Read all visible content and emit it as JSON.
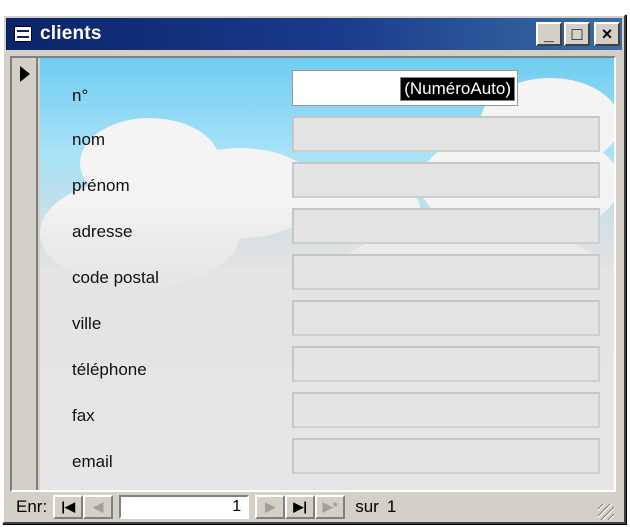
{
  "window": {
    "title": "clients",
    "title_icon": "form-icon",
    "minimize": "_",
    "maximize": "□",
    "close": "×"
  },
  "fields": [
    {
      "label": "n°",
      "value": "(NuméroAuto)"
    },
    {
      "label": "nom",
      "value": ""
    },
    {
      "label": "prénom",
      "value": ""
    },
    {
      "label": "adresse",
      "value": ""
    },
    {
      "label": "code postal",
      "value": ""
    },
    {
      "label": "ville",
      "value": ""
    },
    {
      "label": "téléphone",
      "value": ""
    },
    {
      "label": "fax",
      "value": ""
    },
    {
      "label": "email",
      "value": ""
    }
  ],
  "navigation": {
    "record_label": "Enr:",
    "first": "|◀",
    "previous": "◀",
    "current_record": "1",
    "next": "▶",
    "last": "▶|",
    "new": "▶*",
    "of_label": "sur",
    "total_records": "1"
  },
  "colors": {
    "titlebar": "#0a246a",
    "window_face": "#d4d0c8",
    "sky": "#6fcdf0"
  }
}
